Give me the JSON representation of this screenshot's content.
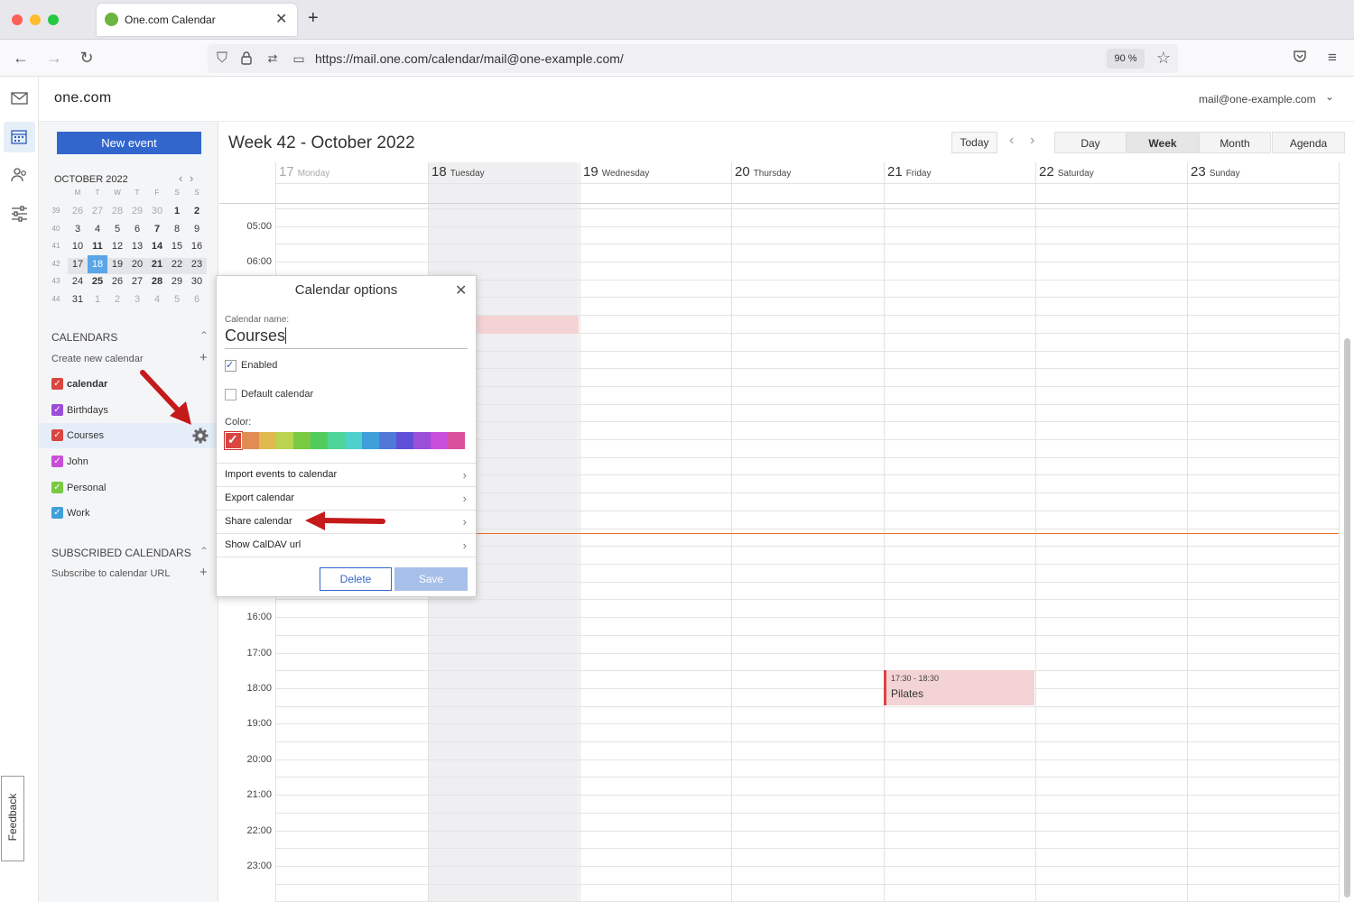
{
  "browser": {
    "tab_title": "One.com Calendar",
    "url": "https://mail.one.com/calendar/mail@one-example.com/",
    "zoom": "90 %",
    "new_tab": "+"
  },
  "app": {
    "logo": "one.com",
    "account": "mail@one-example.com"
  },
  "toolbar": {
    "new_event": "New event",
    "week_title": "Week 42 - October 2022",
    "today": "Today",
    "views": [
      "Day",
      "Week",
      "Month",
      "Agenda"
    ],
    "active_view": "Week"
  },
  "mini_cal": {
    "title": "OCTOBER 2022",
    "dow": [
      "M",
      "T",
      "W",
      "T",
      "F",
      "S",
      "S"
    ],
    "weeks": [
      {
        "wk": "39",
        "days": [
          "26",
          "27",
          "28",
          "29",
          "30",
          "1",
          "2"
        ]
      },
      {
        "wk": "40",
        "days": [
          "3",
          "4",
          "5",
          "6",
          "7",
          "8",
          "9"
        ]
      },
      {
        "wk": "41",
        "days": [
          "10",
          "11",
          "12",
          "13",
          "14",
          "15",
          "16"
        ]
      },
      {
        "wk": "42",
        "days": [
          "17",
          "18",
          "19",
          "20",
          "21",
          "22",
          "23"
        ]
      },
      {
        "wk": "43",
        "days": [
          "24",
          "25",
          "26",
          "27",
          "28",
          "29",
          "30"
        ]
      },
      {
        "wk": "44",
        "days": [
          "31",
          "1",
          "2",
          "3",
          "4",
          "5",
          "6"
        ]
      }
    ],
    "today": "18"
  },
  "calendars": {
    "heading": "CALENDARS",
    "create": "Create new calendar",
    "items": [
      {
        "name": "calendar",
        "color": "#d9463f"
      },
      {
        "name": "Birthdays",
        "color": "#9b4fd9"
      },
      {
        "name": "Courses",
        "color": "#d9463f"
      },
      {
        "name": "John",
        "color": "#c84fd9"
      },
      {
        "name": "Personal",
        "color": "#7ac943"
      },
      {
        "name": "Work",
        "color": "#3fa0d9"
      }
    ]
  },
  "subscribed": {
    "heading": "SUBSCRIBED CALENDARS",
    "subscribe": "Subscribe to calendar URL"
  },
  "feedback": "Feedback",
  "days": [
    {
      "num": "17",
      "name": "Monday"
    },
    {
      "num": "18",
      "name": "Tuesday"
    },
    {
      "num": "19",
      "name": "Wednesday"
    },
    {
      "num": "20",
      "name": "Thursday"
    },
    {
      "num": "21",
      "name": "Friday"
    },
    {
      "num": "22",
      "name": "Saturday"
    },
    {
      "num": "23",
      "name": "Sunday"
    }
  ],
  "hours": [
    "05:00",
    "06:00",
    "16:00",
    "17:00",
    "18:00",
    "19:00",
    "20:00",
    "21:00",
    "22:00",
    "23:00"
  ],
  "event": {
    "time": "17:30 - 18:30",
    "title": "Pilates",
    "color": "#f4d3d4"
  },
  "dialog": {
    "title": "Calendar options",
    "name_label": "Calendar name:",
    "name_value": "Courses",
    "enabled": "Enabled",
    "default": "Default calendar",
    "color_label": "Color:",
    "colors": [
      "#d9463f",
      "#e08c52",
      "#e0b94f",
      "#b9d44f",
      "#7ac943",
      "#4fcc5a",
      "#4fd49a",
      "#4fd0cc",
      "#3fa0d9",
      "#4f78d9",
      "#5f4fd9",
      "#9b4fd9",
      "#c84fd9",
      "#d94f9e"
    ],
    "menu": [
      "Import events to calendar",
      "Export calendar",
      "Share calendar",
      "Show CalDAV url"
    ],
    "delete": "Delete",
    "save": "Save"
  }
}
